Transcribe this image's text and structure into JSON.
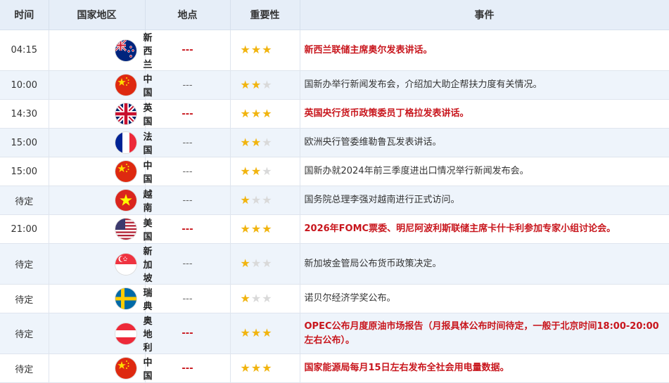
{
  "headers": {
    "time": "时间",
    "region": "国家地区",
    "place": "地点",
    "importance": "重要性",
    "event": "事件"
  },
  "rows": [
    {
      "time": "04:15",
      "country": "新西兰",
      "flag": "nz-flag-icon",
      "place": "---",
      "stars": 3,
      "event": "新西兰联储主席奥尔发表讲话。",
      "highlight": true
    },
    {
      "time": "10:00",
      "country": "中国",
      "flag": "cn-flag-icon",
      "place": "---",
      "stars": 2,
      "event": "国新办举行新闻发布会，介绍加大助企帮扶力度有关情况。",
      "highlight": false
    },
    {
      "time": "14:30",
      "country": "英国",
      "flag": "uk-flag-icon",
      "place": "---",
      "stars": 3,
      "event": "英国央行货币政策委员丁格拉发表讲话。",
      "highlight": true
    },
    {
      "time": "15:00",
      "country": "法国",
      "flag": "fr-flag-icon",
      "place": "---",
      "stars": 2,
      "event": "欧洲央行管委维勒鲁瓦发表讲话。",
      "highlight": false
    },
    {
      "time": "15:00",
      "country": "中国",
      "flag": "cn-flag-icon",
      "place": "---",
      "stars": 2,
      "event": "国新办就2024年前三季度进出口情况举行新闻发布会。",
      "highlight": false
    },
    {
      "time": "待定",
      "country": "越南",
      "flag": "vn-flag-icon",
      "place": "---",
      "stars": 1,
      "event": "国务院总理李强对越南进行正式访问。",
      "highlight": false
    },
    {
      "time": "21:00",
      "country": "美国",
      "flag": "us-flag-icon",
      "place": "---",
      "stars": 3,
      "event": "2026年FOMC票委、明尼阿波利斯联储主席卡什卡利参加专家小组讨论会。",
      "highlight": true
    },
    {
      "time": "待定",
      "country": "新加坡",
      "flag": "sg-flag-icon",
      "place": "---",
      "stars": 1,
      "event": "新加坡金管局公布货币政策决定。",
      "highlight": false
    },
    {
      "time": "待定",
      "country": "瑞典",
      "flag": "se-flag-icon",
      "place": "---",
      "stars": 1,
      "event": "诺贝尔经济学奖公布。",
      "highlight": false
    },
    {
      "time": "待定",
      "country": "奥地利",
      "flag": "at-flag-icon",
      "place": "---",
      "stars": 3,
      "event": "OPEC公布月度原油市场报告（月报具体公布时间待定，一般于北京时间18:00-20:00左右公布）。",
      "highlight": true
    },
    {
      "time": "待定",
      "country": "中国",
      "flag": "cn-flag-icon",
      "place": "---",
      "stars": 3,
      "event": "国家能源局每月15日左右发布全社会用电量数据。",
      "highlight": true
    }
  ],
  "colors": {
    "highlight": "#c8161d",
    "star_on": "#f1b40f",
    "star_off": "#d9d9d9",
    "header_bg": "#e6eef8"
  }
}
